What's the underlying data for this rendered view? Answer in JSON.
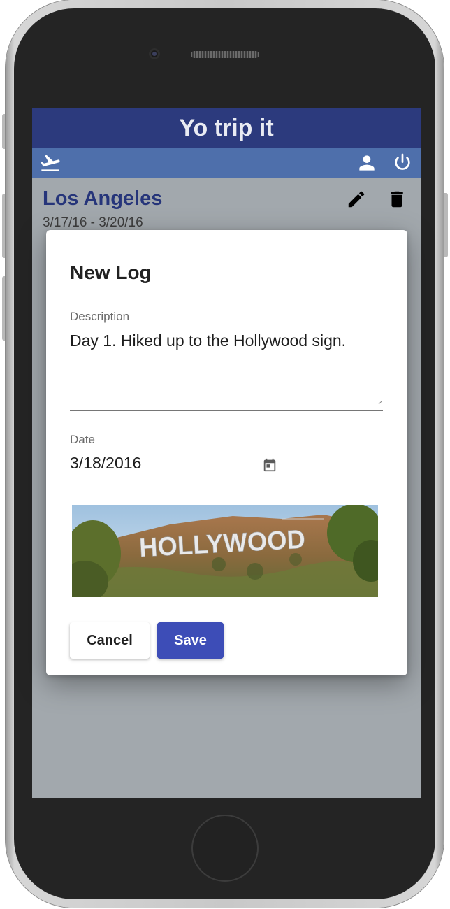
{
  "app": {
    "title": "Yo trip it"
  },
  "nav": {
    "left_icon": "flight-takeoff-icon",
    "right_icons": [
      "account-icon",
      "power-icon"
    ]
  },
  "trip": {
    "title": "Los Angeles",
    "dates": "3/17/16 - 3/20/16",
    "actions": [
      "edit-icon",
      "delete-icon"
    ]
  },
  "dialog": {
    "title": "New Log",
    "description_label": "Description",
    "description_value": "Day 1. Hiked up to the Hollywood sign.",
    "date_label": "Date",
    "date_value": "3/18/2016",
    "date_icon": "calendar-icon",
    "photo_sign_text": "HOLLYWOOD",
    "cancel_label": "Cancel",
    "save_label": "Save"
  },
  "colors": {
    "title_bar": "#2c3a7d",
    "nav_bar": "#4e6fab",
    "trip_title": "#26357a",
    "save_button": "#3d4db7",
    "overlay": "#a2a8ad"
  }
}
